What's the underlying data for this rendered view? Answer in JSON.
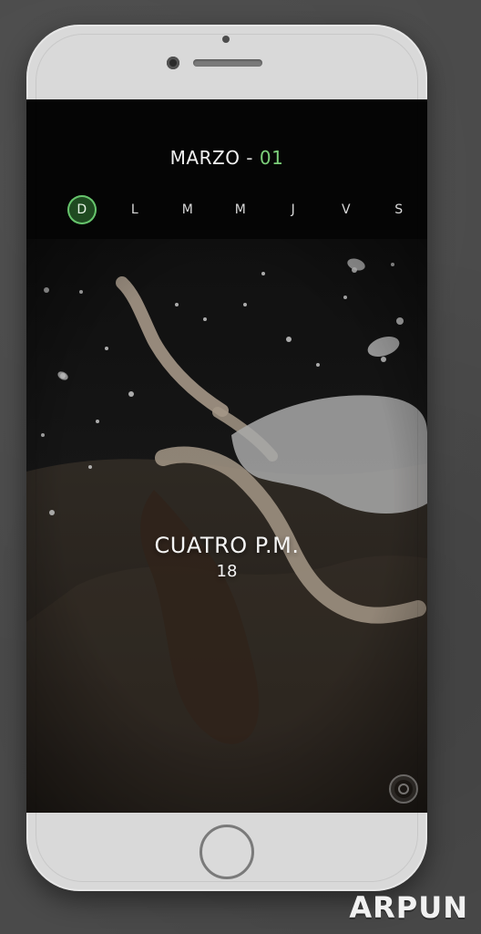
{
  "header": {
    "month": "MARZO",
    "separator": " - ",
    "day": "01"
  },
  "weekdays": {
    "selected_index": 0,
    "items": [
      "D",
      "L",
      "M",
      "M",
      "J",
      "V",
      "S"
    ]
  },
  "main": {
    "time_title": "CUATRO P.M.",
    "time_value": "18"
  },
  "watermark": "ARPUN",
  "colors": {
    "accent_green": "#67c46d",
    "header_bg": "#050505"
  },
  "icons": {
    "corner_button": "camera-icon",
    "home_button": "home-button"
  }
}
